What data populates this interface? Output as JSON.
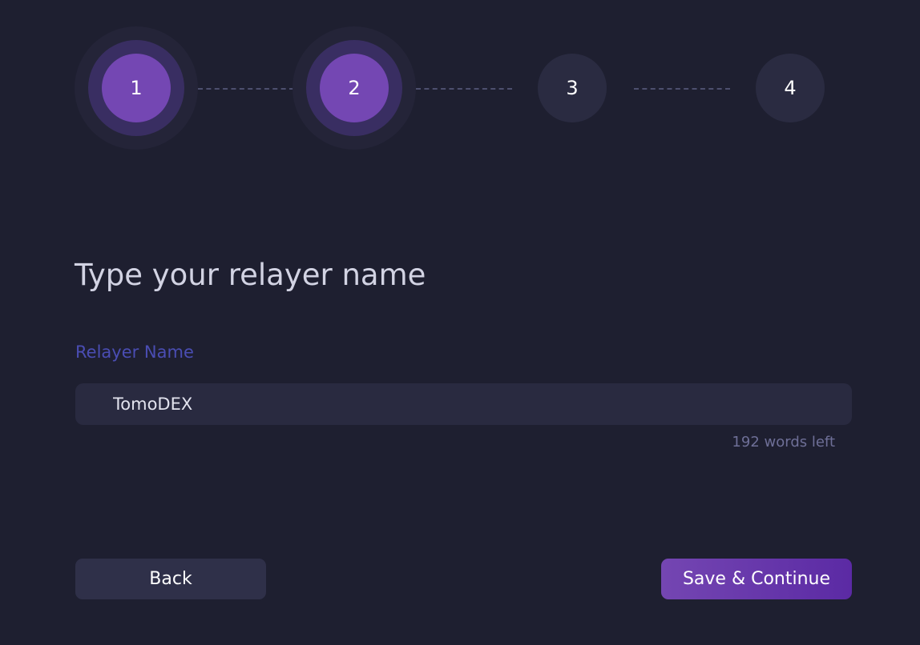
{
  "stepper": {
    "steps": [
      {
        "number": "1",
        "state": "complete"
      },
      {
        "number": "2",
        "state": "active"
      },
      {
        "number": "3",
        "state": "pending"
      },
      {
        "number": "4",
        "state": "pending"
      }
    ]
  },
  "form": {
    "title": "Type your relayer name",
    "name_label": "Relayer Name",
    "name_value": "TomoDEX",
    "words_left": "192 words left"
  },
  "actions": {
    "back_label": "Back",
    "save_label": "Save & Continue"
  },
  "colors": {
    "background": "#1e1f30",
    "accent": "#7447b3",
    "label": "#4a4db3"
  }
}
